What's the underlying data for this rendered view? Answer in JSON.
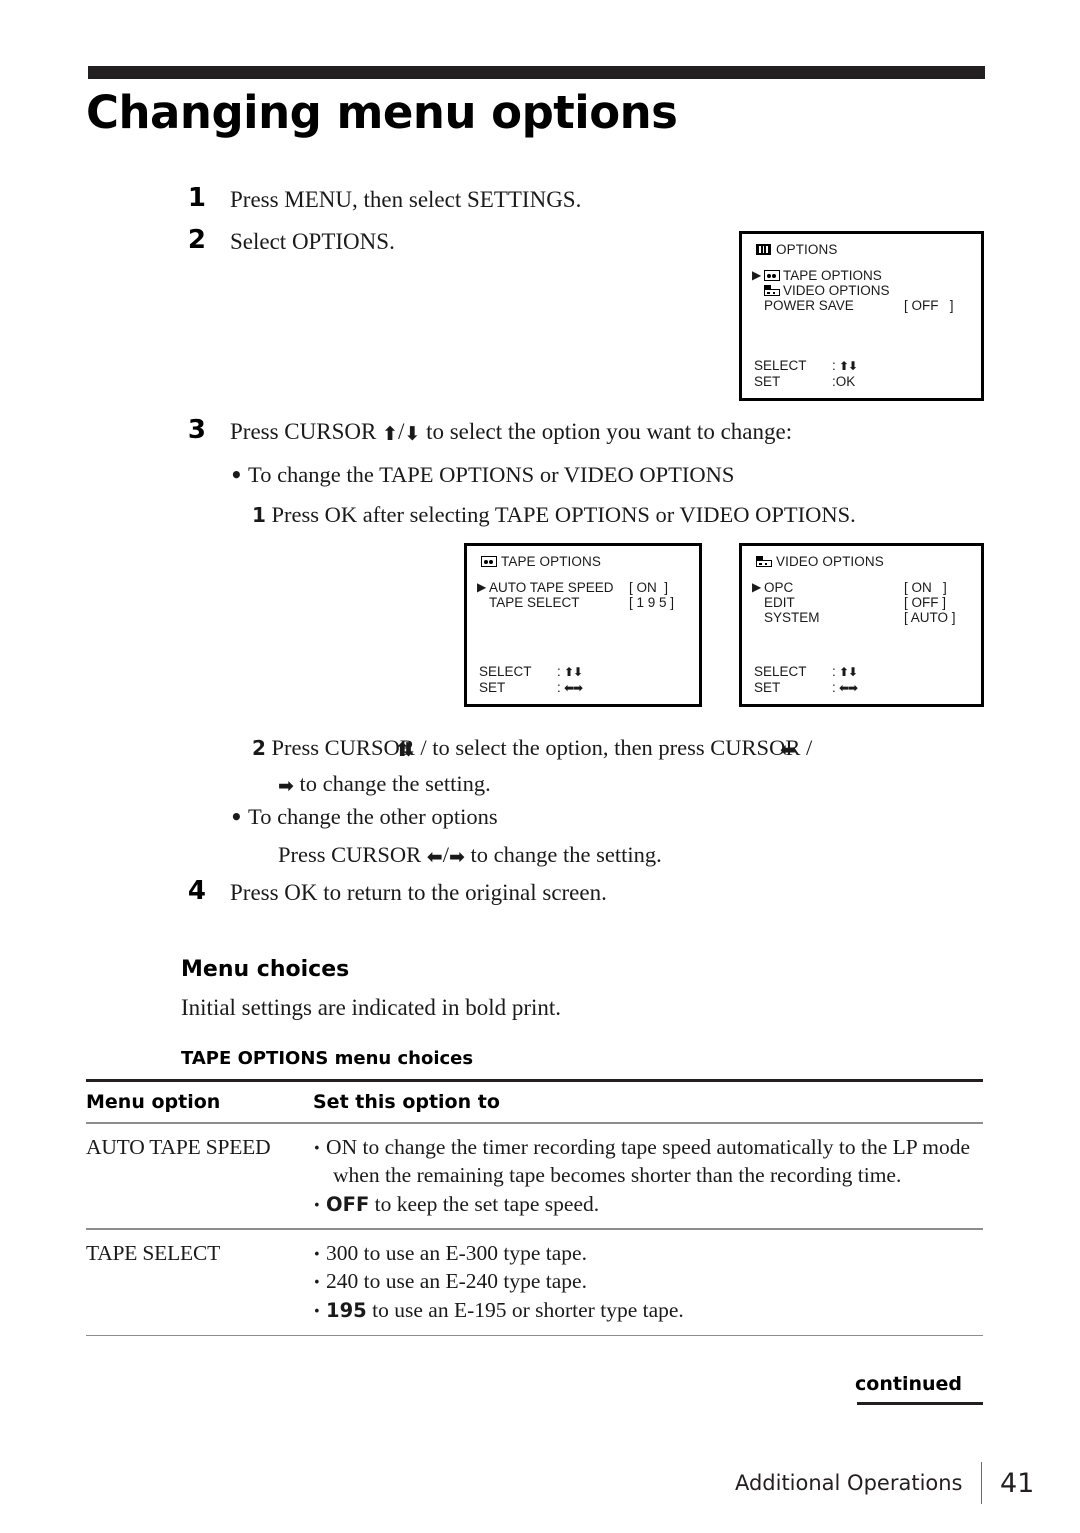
{
  "page": {
    "title": "Changing menu options",
    "footer_section": "Additional Operations",
    "footer_page_number": "41",
    "continued_label": "continued"
  },
  "steps": {
    "s1": {
      "num": "1",
      "text": "Press MENU, then select SETTINGS."
    },
    "s2": {
      "num": "2",
      "text": "Select OPTIONS."
    },
    "s3": {
      "num": "3",
      "text_before": "Press CURSOR ",
      "arrow_up": "⬆",
      "slash": "/",
      "arrow_down": "⬇",
      "text_after": " to select the option you want to change:",
      "bullet_dot": "•",
      "bullet1": "To change the TAPE OPTIONS or VIDEO OPTIONS",
      "sub1_num": "1",
      "sub1_text": "Press OK after selecting TAPE OPTIONS or VIDEO OPTIONS.",
      "sub2_num": "2",
      "sub2_a": "Press CURSOR ",
      "sub2_b": " to select the option, then press CURSOR ",
      "arrow_left": "⬅",
      "arrow_right": "➡",
      "sub2_c": "/",
      "sub2_d": " to change the setting.",
      "bullet2": "To change the other options",
      "sub3_a": "Press CURSOR ",
      "sub3_b": "/",
      "sub3_c": " to change the setting."
    },
    "s4": {
      "num": "4",
      "text": "Press OK to return to the original screen."
    }
  },
  "osd_options": {
    "icon": "options-icon",
    "title": "OPTIONS",
    "rows": [
      {
        "caret": "▶",
        "icon": "tape-icon",
        "label": "TAPE OPTIONS",
        "value": ""
      },
      {
        "caret": "",
        "icon": "video-icon",
        "label": "VIDEO OPTIONS",
        "value": ""
      },
      {
        "caret": "",
        "icon": "",
        "label": "POWER SAVE",
        "value": "[ OFF   ]"
      }
    ],
    "footer": [
      {
        "key": "SELECT",
        "sep": ":",
        "value": "updown-arrows"
      },
      {
        "key": "SET",
        "sep": ":",
        "value": "OK"
      }
    ]
  },
  "osd_tape": {
    "icon": "tape-icon",
    "title": "TAPE OPTIONS",
    "rows": [
      {
        "caret": "▶",
        "label": "AUTO TAPE SPEED",
        "value": "[ ON  ]"
      },
      {
        "caret": "",
        "label": "TAPE SELECT",
        "value": "[ 1 9 5 ]"
      }
    ],
    "footer": [
      {
        "key": "SELECT",
        "sep": ":",
        "value": "updown-arrows"
      },
      {
        "key": "SET",
        "sep": ":",
        "value": "leftright-arrows"
      }
    ]
  },
  "osd_video": {
    "icon": "video-icon",
    "title": "VIDEO OPTIONS",
    "rows": [
      {
        "caret": "▶",
        "label": "OPC",
        "value": "[ ON   ]"
      },
      {
        "caret": "",
        "label": "EDIT",
        "value": "[ OFF ]"
      },
      {
        "caret": "",
        "label": "SYSTEM",
        "value": "[ AUTO ]"
      }
    ],
    "footer": [
      {
        "key": "SELECT",
        "sep": ":",
        "value": "updown-arrows"
      },
      {
        "key": "SET",
        "sep": ":",
        "value": "leftright-arrows"
      }
    ]
  },
  "menu_choices": {
    "heading": "Menu choices",
    "subtext": "Initial settings are indicated in bold print.",
    "table_caption": "TAPE OPTIONS menu choices",
    "columns": [
      "Menu option",
      "Set this option to"
    ],
    "rows": [
      {
        "option": "AUTO TAPE SPEED",
        "items": [
          {
            "lead": "ON",
            "lead_bold": false,
            "rest": " to change the timer recording tape speed automatically to the LP mode when the remaining tape becomes shorter than the recording time."
          },
          {
            "lead": "OFF",
            "lead_bold": true,
            "rest": " to keep the set tape speed."
          }
        ]
      },
      {
        "option": "TAPE SELECT",
        "items": [
          {
            "lead": "300",
            "lead_bold": false,
            "rest": " to use an E-300 type tape."
          },
          {
            "lead": "240",
            "lead_bold": false,
            "rest": " to use an E-240 type tape."
          },
          {
            "lead": "195",
            "lead_bold": true,
            "rest": " to use an E-195 or shorter type tape."
          }
        ]
      }
    ],
    "bullet": "•"
  },
  "colors": {
    "rule": "#231f20",
    "thin_rule": "#8d8d8d",
    "text": "#1a1a1a"
  }
}
